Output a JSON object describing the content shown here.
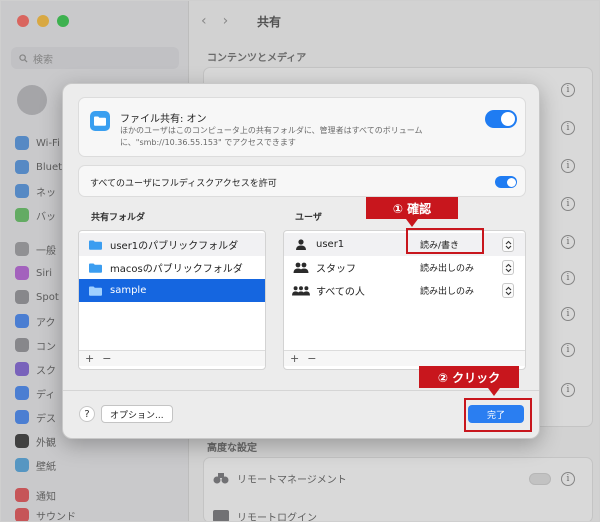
{
  "background": {
    "search_placeholder": "検索",
    "sidebar_items": [
      "Wi-Fi",
      "Bluet",
      "ネッ",
      "バッ",
      "一般",
      "Siri",
      "Spot",
      "アク",
      "コン",
      "スク",
      "ディ",
      "デス",
      "外観",
      "壁紙",
      "通知",
      "サウンド"
    ],
    "page_title": "共有",
    "section_contents": "コンテンツとメディア",
    "section_advanced": "高度な設定",
    "row_remote_management": "リモートマネージメント",
    "row_remote_login": "リモートログイン"
  },
  "dialog": {
    "file_sharing_title": "ファイル共有: オン",
    "file_sharing_desc": "ほかのユーザはこのコンピュータ上の共有フォルダに、管理者はすべてのボリュームに、\"smb://10.36.55.153\" でアクセスできます",
    "full_disk_label": "すべてのユーザにフルディスクアクセスを許可",
    "folders_header": "共有フォルダ",
    "users_header": "ユーザ",
    "folders": [
      {
        "name": "user1のパブリックフォルダ"
      },
      {
        "name": "macosのパブリックフォルダ"
      },
      {
        "name": "sample"
      }
    ],
    "users": [
      {
        "name": "user1",
        "permission": "読み/書き"
      },
      {
        "name": "スタッフ",
        "permission": "読み出しのみ"
      },
      {
        "name": "すべての人",
        "permission": "読み出しのみ"
      }
    ],
    "plus": "+",
    "minus": "−",
    "help": "?",
    "options_label": "オプション...",
    "done_label": "完了"
  },
  "annotations": {
    "step1": "① 確認",
    "step2": "② クリック"
  },
  "colors": {
    "accent": "#1f7cf2",
    "selection": "#1566e0",
    "annotation": "#c8161d"
  }
}
